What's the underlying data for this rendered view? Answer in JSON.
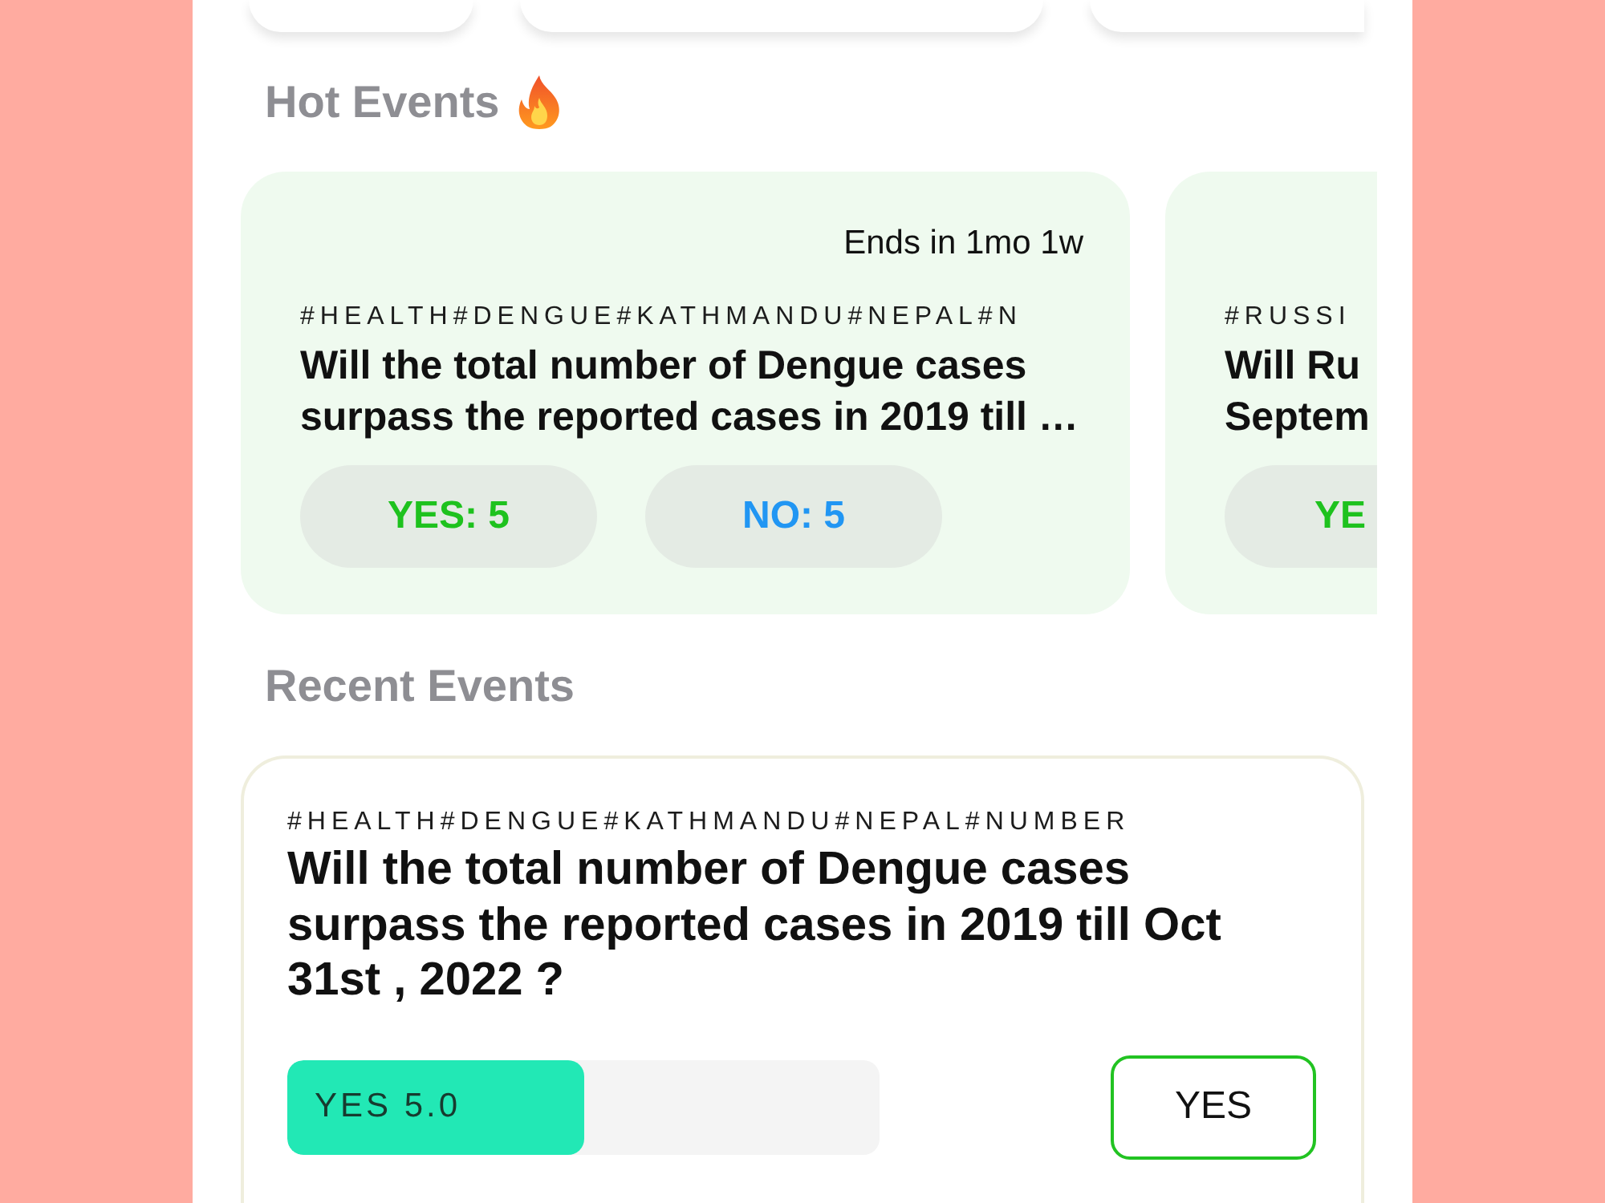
{
  "hot_events": {
    "title": "Hot Events",
    "events": [
      {
        "cut_off": false,
        "ends": "Ends in 1mo 1w",
        "tags": "#HEALTH#DENGUE#KATHMANDU#NEPAL#N",
        "title_lines": [
          "Will the total number of Dengue cases",
          "surpass the reported cases in 2019 till …"
        ],
        "votes": [
          {
            "kind": "yes",
            "label": "YES: 5"
          },
          {
            "kind": "no",
            "label": "NO: 5"
          }
        ]
      },
      {
        "cut_off": true,
        "tags": "#RUSSI",
        "title_lines": [
          "Will Ru",
          "Septem"
        ],
        "votes": [
          {
            "kind": "yes",
            "label": "YE"
          }
        ]
      }
    ]
  },
  "recent_events": {
    "title": "Recent Events",
    "events": [
      {
        "tags": "#HEALTH#DENGUE#KATHMANDU#NEPAL#NUMBER",
        "title": "Will the total number of Dengue cases surpass the reported cases in 2019 till Oct 31st , 2022 ?",
        "result": {
          "label": "YES 5.0",
          "level": 0.5
        },
        "action": "YES"
      }
    ]
  }
}
